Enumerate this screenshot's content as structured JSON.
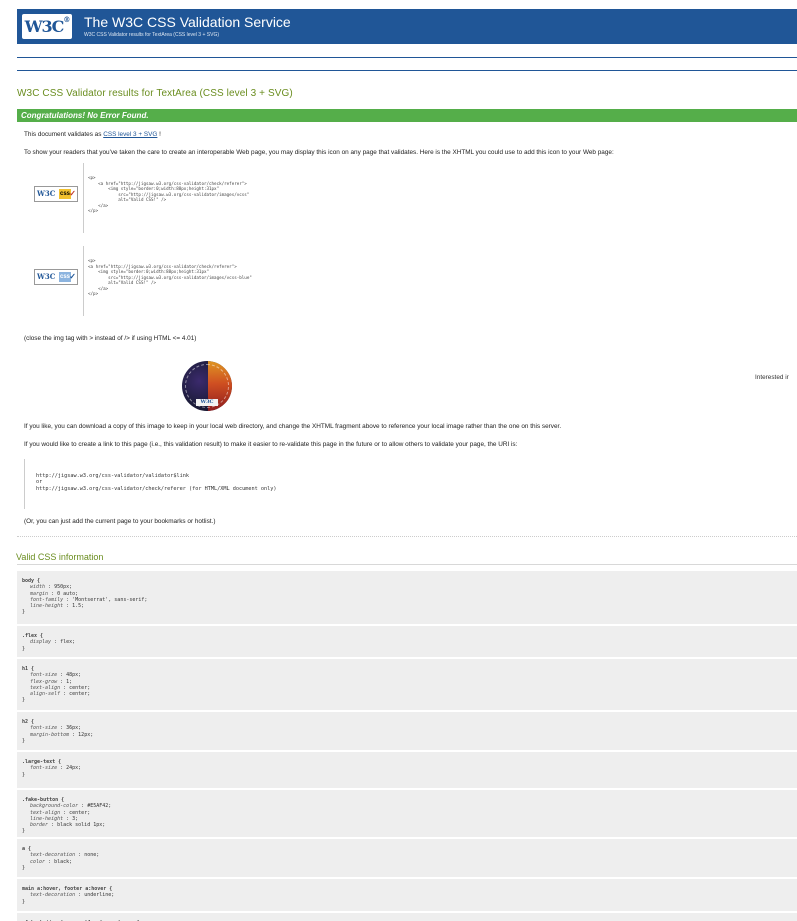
{
  "banner": {
    "logo_text": "W3C",
    "logo_mark": "®",
    "title": "The W3C CSS Validation Service",
    "subtitle": "W3C CSS Validator results for TextArea (CSS level 3 + SVG)"
  },
  "results_title": "W3C CSS Validator results for TextArea (CSS level 3 + SVG)",
  "congrats": "Congratulations! No Error Found.",
  "validates": {
    "prefix": "This document validates as ",
    "link": "CSS level 3 + SVG",
    "suffix": " !"
  },
  "show_readers": "To show your readers that you've taken the care to create an interoperable Web page, you may display this icon on any page that validates. Here is the XHTML you could use to add this icon to your Web page:",
  "badges": [
    {
      "w3": "W3C",
      "css": "css",
      "check": "✓",
      "snippet": "<p>\n    <a href=\"http://jigsaw.w3.org/css-validator/check/referer\">\n        <img style=\"border:0;width:88px;height:31px\"\n            src=\"http://jigsaw.w3.org/css-validator/images/vcss\"\n            alt=\"Valid CSS!\" />\n    </a>\n</p>"
    },
    {
      "w3": "W3C",
      "css": "css",
      "check": "✓",
      "snippet": "<p>\n<a href=\"http://jigsaw.w3.org/css-validator/check/referer\">\n    <img style=\"border:0;width:88px;height:31px\"\n        src=\"http://jigsaw.w3.org/css-validator/images/vcss-blue\"\n        alt=\"Valid CSS!\" />\n    </a>\n</p>"
    }
  ],
  "close_img_note": "(close the img tag with > instead of /> if using HTML <= 4.01)",
  "sticker_mark": "W3C",
  "interested": "Interested ir",
  "download_note": "If you like, you can download a copy of this image to keep in your local web directory, and change the XHTML fragment above to reference your local image rather than the one on this server.",
  "link_note": "If you would like to create a link to this page (i.e., this validation result) to make it easier to re-validate this page in the future or to allow others to validate your page, the URI is:",
  "uri_code": "http://jigsaw.w3.org/css-validator/validator$link\nor\nhttp://jigsaw.w3.org/css-validator/check/referer (for HTML/XML document only)",
  "bookmark_note": "(Or, you can just add the current page to your bookmarks or hotlist.)",
  "valid_css_title": "Valid CSS information",
  "css_rules": [
    {
      "selector": "body {",
      "decls": [
        [
          "width",
          "950px;"
        ],
        [
          "margin",
          "0 auto;"
        ],
        [
          "font-family",
          "'Montserrat', sans-serif;"
        ],
        [
          "line-height",
          "1.5;"
        ]
      ]
    },
    {
      "selector": ".flex {",
      "decls": [
        [
          "display",
          "flex;"
        ]
      ]
    },
    {
      "selector": "h1 {",
      "decls": [
        [
          "font-size",
          "48px;"
        ],
        [
          "flex-grow",
          "1;"
        ],
        [
          "text-align",
          "center;"
        ],
        [
          "align-self",
          "center;"
        ]
      ]
    },
    {
      "selector": "h2 {",
      "decls": [
        [
          "font-size",
          "36px;"
        ],
        [
          "margin-bottom",
          "12px;"
        ]
      ]
    },
    {
      "selector": ".large-text {",
      "decls": [
        [
          "font-size",
          "24px;"
        ]
      ]
    },
    {
      "selector": ".fake-button {",
      "decls": [
        [
          "background-color",
          "#E5AF42;"
        ],
        [
          "text-align",
          "center;"
        ],
        [
          "line-height",
          "3;"
        ],
        [
          "border",
          "black solid 1px;"
        ]
      ]
    },
    {
      "selector": "a {",
      "decls": [
        [
          "text-decoration",
          "none;"
        ],
        [
          "color",
          "black;"
        ]
      ]
    },
    {
      "selector": "main a:hover, footer a:hover {",
      "decls": [
        [
          "text-decoration",
          "underline;"
        ]
      ]
    },
    {
      "selector": ".fake-button:hover, .blue-hover:hover {",
      "decls": []
    }
  ],
  "colors": {
    "banner_bg": "#205697",
    "accent_green_text": "#6a8d1f",
    "congrats_bg": "#55ae4a",
    "code_bg": "#eeeeee"
  }
}
